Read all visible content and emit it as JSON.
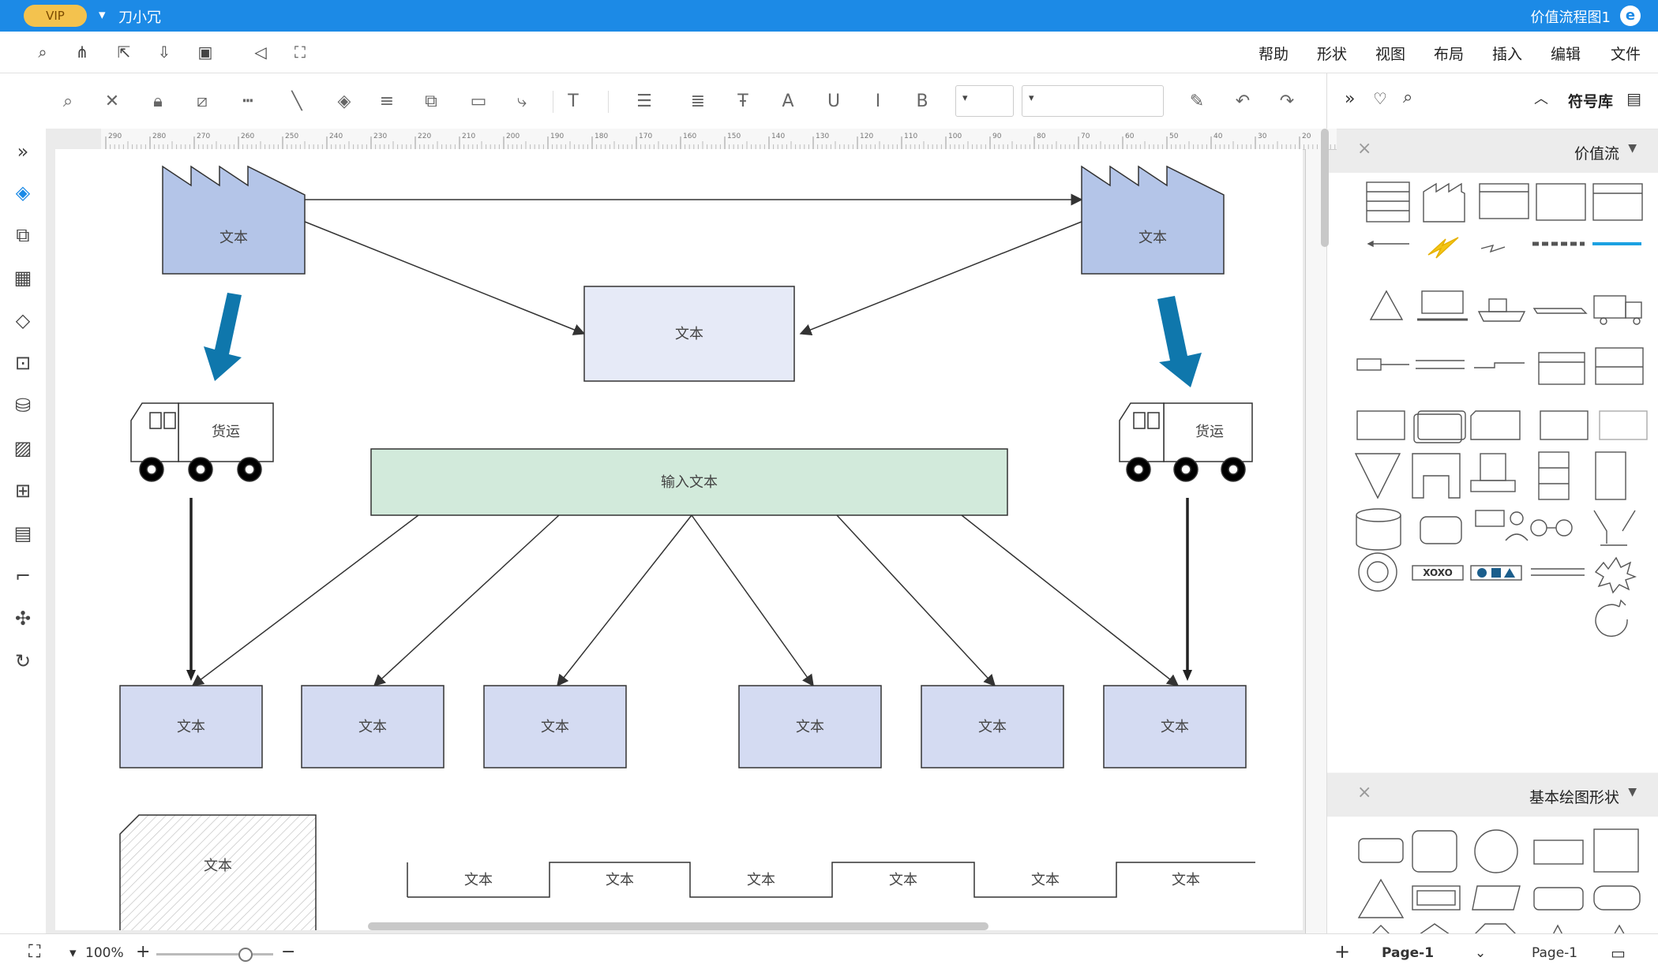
{
  "app": {
    "title": "价值流程图1",
    "logo_letter": "e",
    "vip_label": "VIP",
    "user_name": "刀小冗",
    "user_dropdown": "▾"
  },
  "menu": {
    "items": [
      "文件",
      "编辑",
      "插入",
      "布局",
      "视图",
      "形状",
      "帮助"
    ]
  },
  "toolbar": {
    "font_family_value": "",
    "font_size_value": ""
  },
  "library": {
    "title": "符号库",
    "sections": [
      {
        "title": "价值流"
      },
      {
        "title": "基本绘图形状"
      }
    ]
  },
  "canvas": {
    "factory_left_label": "文本",
    "factory_right_label": "文本",
    "center_box_label": "文本",
    "truck_left_label": "货运",
    "truck_right_label": "货运",
    "input_bar_label": "输入文本",
    "bottom_boxes": [
      "文本",
      "文本",
      "文本",
      "文本",
      "文本",
      "文本"
    ],
    "hatched_label": "文本",
    "timeline_labels": [
      "文本",
      "文本",
      "文本",
      "文本",
      "文本",
      "文本"
    ],
    "ruler_ticks": [
      "290",
      "280",
      "270",
      "260",
      "250",
      "240",
      "230",
      "220",
      "210",
      "200",
      "190",
      "180",
      "170",
      "160",
      "150",
      "140",
      "130",
      "120",
      "110",
      "100",
      "90",
      "80",
      "70",
      "60",
      "50",
      "40",
      "30",
      "20"
    ]
  },
  "status": {
    "zoom": "100%",
    "current_page": "Page-1",
    "page_selector": "Page-1"
  },
  "colors": {
    "accent": "#1c8ae6",
    "factory_fill": "#b4c5e8",
    "box_fill": "#d4dbf2",
    "center_fill": "#e6eaf7",
    "input_fill": "#d2eadb",
    "arrow_blue": "#0f77ac"
  }
}
